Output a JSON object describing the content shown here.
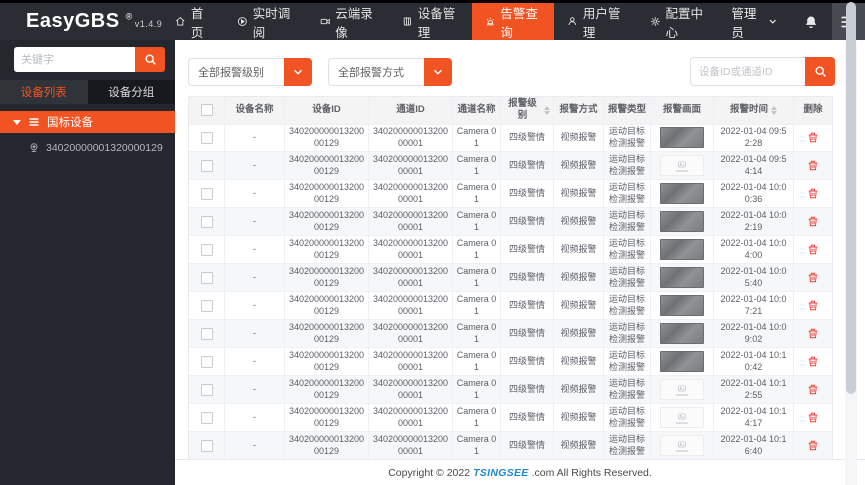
{
  "navbar": {
    "logo": "EasyGBS",
    "logo_mark": "®",
    "version": "v1.4.9",
    "items": [
      {
        "label": "首页",
        "icon": "home-icon",
        "active": false
      },
      {
        "label": "实时调阅",
        "icon": "play-icon",
        "active": false
      },
      {
        "label": "云端录像",
        "icon": "video-camera-icon",
        "active": false
      },
      {
        "label": "设备管理",
        "icon": "device-icon",
        "active": false
      },
      {
        "label": "告警查询",
        "icon": "alarm-icon",
        "active": true
      },
      {
        "label": "用户管理",
        "icon": "user-icon",
        "active": false
      },
      {
        "label": "配置中心",
        "icon": "gear-icon",
        "active": false
      }
    ],
    "user_menu_label": "管理员"
  },
  "sidebar": {
    "search_placeholder": "关键字",
    "tabs": [
      {
        "label": "设备列表",
        "active": true
      },
      {
        "label": "设备分组",
        "active": false
      }
    ],
    "tree_root_label": "国标设备",
    "device_item": "34020000001320000129"
  },
  "filters": {
    "alarm_level_value": "全部报警级别",
    "alarm_method_value": "全部报警方式",
    "search_placeholder": "设备ID或通道ID"
  },
  "table": {
    "headers": [
      "设备名称",
      "设备ID",
      "通道ID",
      "通道名称",
      "报警级别",
      "报警方式",
      "报警类型",
      "报警画面",
      "报警时间",
      "删除"
    ],
    "rows": [
      {
        "device_name": "-",
        "device_id": "34020000001320000129",
        "channel_id": "34020000001320000001",
        "channel_name": "Camera 01",
        "alarm_level": "四级警情",
        "alarm_method": "视频报警",
        "alarm_type": "运动目标检测报警",
        "thumb": "image",
        "time": "2022-01-04 09:52:28"
      },
      {
        "device_name": "-",
        "device_id": "34020000001320000129",
        "channel_id": "34020000001320000001",
        "channel_name": "Camera 01",
        "alarm_level": "四级警情",
        "alarm_method": "视频报警",
        "alarm_type": "运动目标检测报警",
        "thumb": "placeholder",
        "time": "2022-01-04 09:54:14"
      },
      {
        "device_name": "-",
        "device_id": "34020000001320000129",
        "channel_id": "34020000001320000001",
        "channel_name": "Camera 01",
        "alarm_level": "四级警情",
        "alarm_method": "视频报警",
        "alarm_type": "运动目标检测报警",
        "thumb": "image",
        "time": "2022-01-04 10:00:36"
      },
      {
        "device_name": "-",
        "device_id": "34020000001320000129",
        "channel_id": "34020000001320000001",
        "channel_name": "Camera 01",
        "alarm_level": "四级警情",
        "alarm_method": "视频报警",
        "alarm_type": "运动目标检测报警",
        "thumb": "image",
        "time": "2022-01-04 10:02:19"
      },
      {
        "device_name": "-",
        "device_id": "34020000001320000129",
        "channel_id": "34020000001320000001",
        "channel_name": "Camera 01",
        "alarm_level": "四级警情",
        "alarm_method": "视频报警",
        "alarm_type": "运动目标检测报警",
        "thumb": "image",
        "time": "2022-01-04 10:04:00"
      },
      {
        "device_name": "-",
        "device_id": "34020000001320000129",
        "channel_id": "34020000001320000001",
        "channel_name": "Camera 01",
        "alarm_level": "四级警情",
        "alarm_method": "视频报警",
        "alarm_type": "运动目标检测报警",
        "thumb": "image",
        "time": "2022-01-04 10:05:40"
      },
      {
        "device_name": "-",
        "device_id": "34020000001320000129",
        "channel_id": "34020000001320000001",
        "channel_name": "Camera 01",
        "alarm_level": "四级警情",
        "alarm_method": "视频报警",
        "alarm_type": "运动目标检测报警",
        "thumb": "image",
        "time": "2022-01-04 10:07:21"
      },
      {
        "device_name": "-",
        "device_id": "34020000001320000129",
        "channel_id": "34020000001320000001",
        "channel_name": "Camera 01",
        "alarm_level": "四级警情",
        "alarm_method": "视频报警",
        "alarm_type": "运动目标检测报警",
        "thumb": "image",
        "time": "2022-01-04 10:09:02"
      },
      {
        "device_name": "-",
        "device_id": "34020000001320000129",
        "channel_id": "34020000001320000001",
        "channel_name": "Camera 01",
        "alarm_level": "四级警情",
        "alarm_method": "视频报警",
        "alarm_type": "运动目标检测报警",
        "thumb": "image",
        "time": "2022-01-04 10:10:42"
      },
      {
        "device_name": "-",
        "device_id": "34020000001320000129",
        "channel_id": "34020000001320000001",
        "channel_name": "Camera 01",
        "alarm_level": "四级警情",
        "alarm_method": "视频报警",
        "alarm_type": "运动目标检测报警",
        "thumb": "placeholder",
        "time": "2022-01-04 10:12:55"
      },
      {
        "device_name": "-",
        "device_id": "34020000001320000129",
        "channel_id": "34020000001320000001",
        "channel_name": "Camera 01",
        "alarm_level": "四级警情",
        "alarm_method": "视频报警",
        "alarm_type": "运动目标检测报警",
        "thumb": "placeholder",
        "time": "2022-01-04 10:14:17"
      },
      {
        "device_name": "-",
        "device_id": "34020000001320000129",
        "channel_id": "34020000001320000001",
        "channel_name": "Camera 01",
        "alarm_level": "四级警情",
        "alarm_method": "视频报警",
        "alarm_type": "运动目标检测报警",
        "thumb": "placeholder",
        "time": "2022-01-04 10:16:40"
      }
    ]
  },
  "footer": {
    "prefix": "Copyright © 2022",
    "brand": "TSINGSEE",
    "suffix": ".com All Rights Reserved."
  },
  "colors": {
    "accent": "#f25322",
    "navbar_bg": "#2a2d33",
    "sidebar_bg": "#24272d",
    "danger": "#ef4136",
    "brand_blue": "#1e88d2"
  }
}
